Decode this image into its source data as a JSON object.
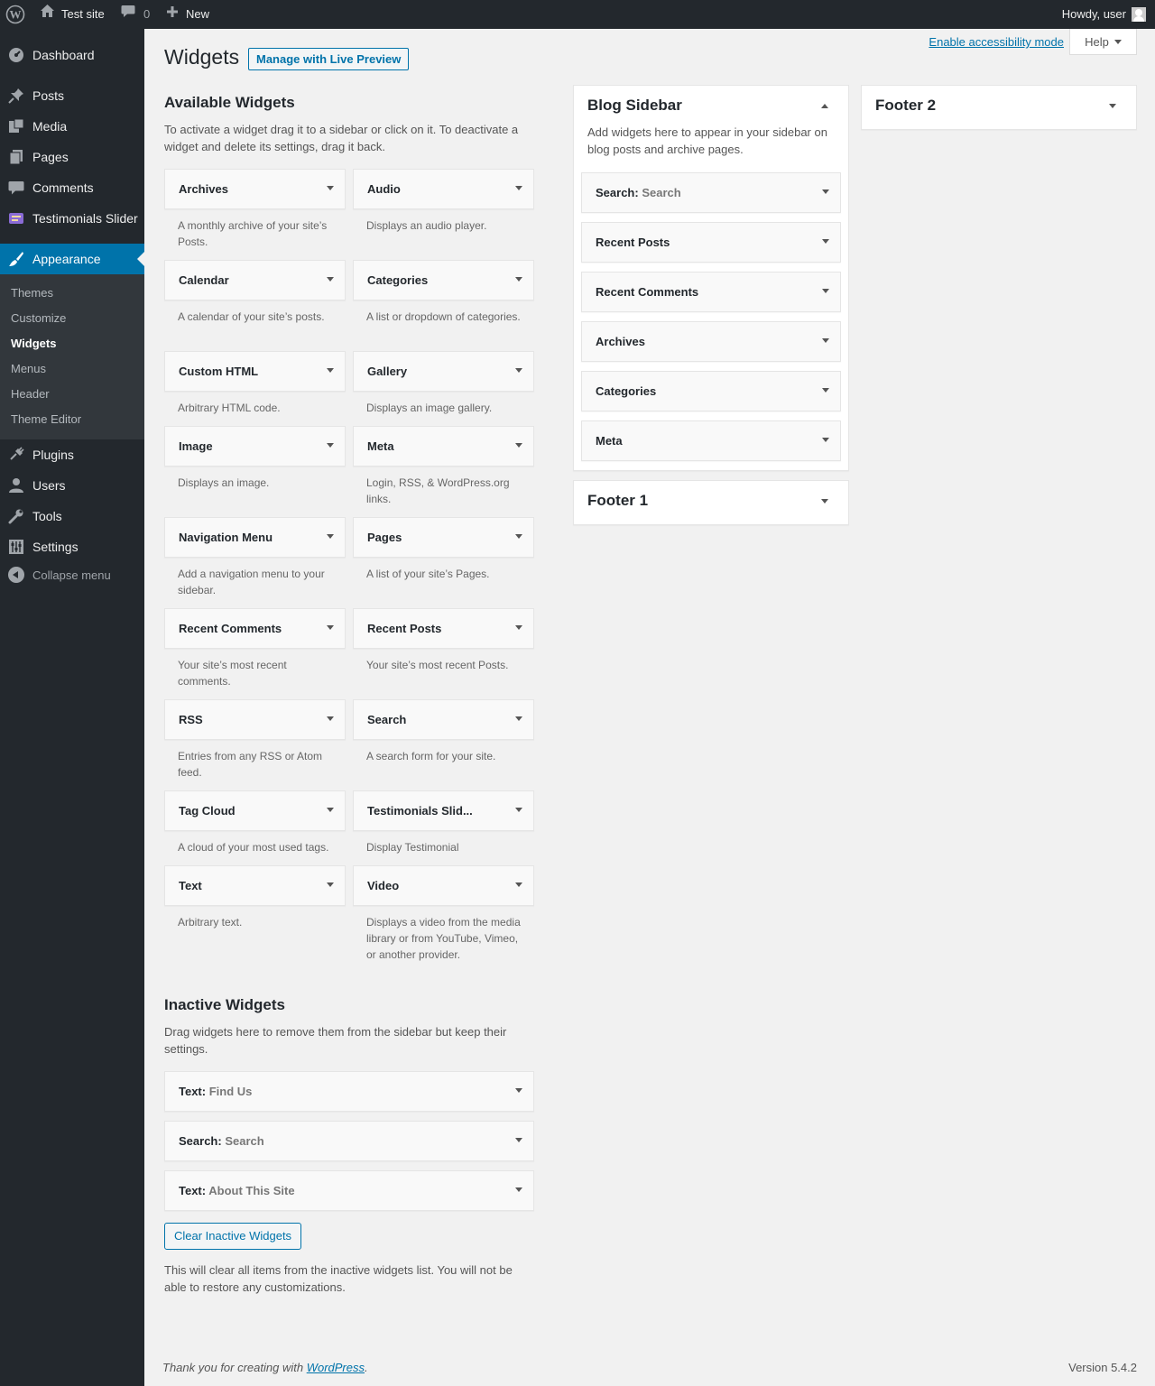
{
  "adminbar": {
    "site_name": "Test site",
    "comment_count": "0",
    "new_label": "New",
    "howdy": "Howdy, user"
  },
  "menu": {
    "dashboard": "Dashboard",
    "posts": "Posts",
    "media": "Media",
    "pages": "Pages",
    "comments": "Comments",
    "testimonials": "Testimonials Slider",
    "appearance": "Appearance",
    "sub": [
      "Themes",
      "Customize",
      "Widgets",
      "Menus",
      "Header",
      "Theme Editor"
    ],
    "plugins": "Plugins",
    "users": "Users",
    "tools": "Tools",
    "settings": "Settings",
    "collapse": "Collapse menu"
  },
  "screen": {
    "accessibility": "Enable accessibility mode",
    "help": "Help"
  },
  "page": {
    "title": "Widgets",
    "live_preview": "Manage with Live Preview"
  },
  "available": {
    "heading": "Available Widgets",
    "desc": "To activate a widget drag it to a sidebar or click on it. To deactivate a widget and delete its settings, drag it back.",
    "widgets": [
      {
        "title": "Archives",
        "desc": "A monthly archive of your site’s Posts."
      },
      {
        "title": "Audio",
        "desc": "Displays an audio player."
      },
      {
        "title": "Calendar",
        "desc": "A calendar of your site’s posts."
      },
      {
        "title": "Categories",
        "desc": "A list or dropdown of categories."
      },
      {
        "title": "Custom HTML",
        "desc": "Arbitrary HTML code."
      },
      {
        "title": "Gallery",
        "desc": "Displays an image gallery."
      },
      {
        "title": "Image",
        "desc": "Displays an image."
      },
      {
        "title": "Meta",
        "desc": "Login, RSS, & WordPress.org links."
      },
      {
        "title": "Navigation Menu",
        "desc": "Add a navigation menu to your sidebar."
      },
      {
        "title": "Pages",
        "desc": "A list of your site’s Pages."
      },
      {
        "title": "Recent Comments",
        "desc": "Your site’s most recent comments."
      },
      {
        "title": "Recent Posts",
        "desc": "Your site’s most recent Posts."
      },
      {
        "title": "RSS",
        "desc": "Entries from any RSS or Atom feed."
      },
      {
        "title": "Search",
        "desc": "A search form for your site."
      },
      {
        "title": "Tag Cloud",
        "desc": "A cloud of your most used tags."
      },
      {
        "title": "Testimonials Slid...",
        "desc": "Display Testimonial"
      },
      {
        "title": "Text",
        "desc": "Arbitrary text."
      },
      {
        "title": "Video",
        "desc": "Displays a video from the media library or from YouTube, Vimeo, or another provider."
      }
    ]
  },
  "blog_sidebar": {
    "title": "Blog Sidebar",
    "desc": "Add widgets here to appear in your sidebar on blog posts and archive pages.",
    "widgets": [
      {
        "title": "Search:",
        "sub": "Search"
      },
      {
        "title": "Recent Posts",
        "sub": ""
      },
      {
        "title": "Recent Comments",
        "sub": ""
      },
      {
        "title": "Archives",
        "sub": ""
      },
      {
        "title": "Categories",
        "sub": ""
      },
      {
        "title": "Meta",
        "sub": ""
      }
    ]
  },
  "footer1": {
    "title": "Footer 1"
  },
  "footer2": {
    "title": "Footer 2"
  },
  "inactive": {
    "heading": "Inactive Widgets",
    "desc": "Drag widgets here to remove them from the sidebar but keep their settings.",
    "widgets": [
      {
        "title": "Text:",
        "sub": "Find Us"
      },
      {
        "title": "Search:",
        "sub": "Search"
      },
      {
        "title": "Text:",
        "sub": "About This Site"
      }
    ],
    "clear_button": "Clear Inactive Widgets",
    "clear_note": "This will clear all items from the inactive widgets list. You will not be able to restore any customizations."
  },
  "footer": {
    "thanks_prefix": "Thank you for creating with",
    "thanks_link": "WordPress",
    "thanks_suffix": ".",
    "version": "Version 5.4.2"
  }
}
